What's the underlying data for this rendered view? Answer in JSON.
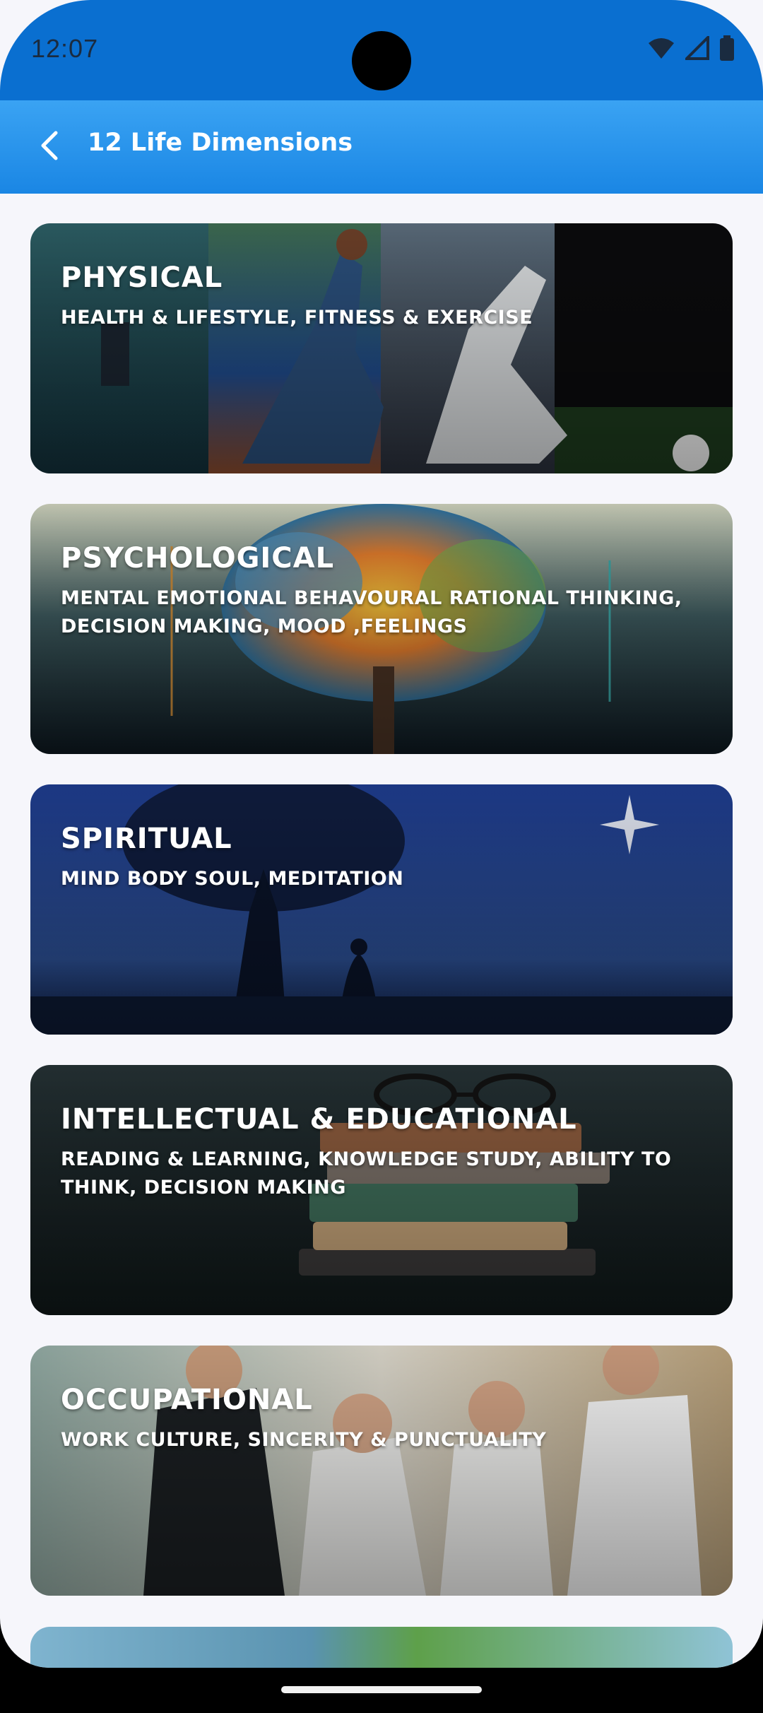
{
  "status_bar": {
    "time": "12:07",
    "icons": [
      "wifi-icon",
      "cellular-signal-icon",
      "battery-icon"
    ]
  },
  "app_bar": {
    "back_icon": "chevron-left-icon",
    "title": "12 Life Dimensions",
    "accent_top": "#3aa3f3",
    "accent_bottom": "#1a86e4"
  },
  "cards": [
    {
      "title": "PHYSICAL",
      "subtitle": "HEALTH & LIFESTYLE, FITNESS & EXERCISE",
      "image": "sports-collage"
    },
    {
      "title": "PSYCHOLOGICAL",
      "subtitle": "MENTAL EMOTIONAL BEHAVOURAL RATIONAL THINKING, DECISION MAKING, MOOD ,FEELINGS",
      "image": "colorful-brain-tree"
    },
    {
      "title": "SPIRITUAL",
      "subtitle": "MIND BODY SOUL, MEDITATION",
      "image": "meditation-under-tree-night"
    },
    {
      "title": "INTELLECTUAL & EDUCATIONAL",
      "subtitle": " READING & LEARNING, KNOWLEDGE STUDY, ABILITY TO THINK, DECISION MAKING",
      "image": "stacked-books-glasses"
    },
    {
      "title": "OCCUPATIONAL",
      "subtitle": "WORK CULTURE, SINCERITY & PUNCTUALITY",
      "image": "office-team-laughing"
    }
  ]
}
